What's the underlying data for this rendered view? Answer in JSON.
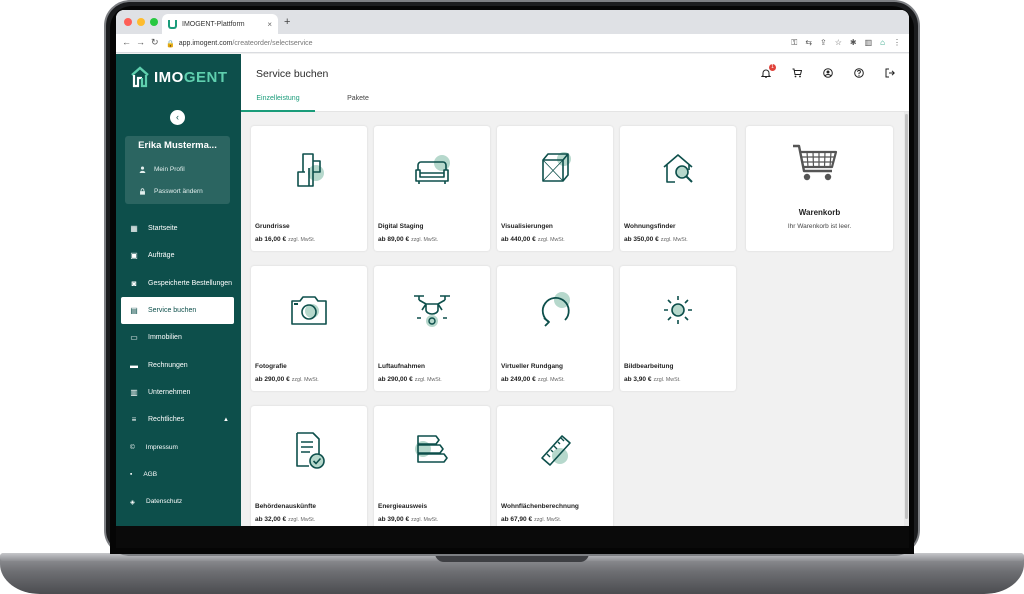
{
  "browser": {
    "tab_title": "IMOGENT-Plattform",
    "tab_close": "×",
    "new_tab": "+",
    "url_host": "app.imogent.com",
    "url_path": "/createorder/selectservice"
  },
  "brand": {
    "logo_im": "IMO",
    "logo_gent": "GENT",
    "primary_color": "#0d4f4b",
    "accent_color": "#1a9c7a"
  },
  "sidebar": {
    "profile_name": "Erika Musterma...",
    "profile_links": [
      {
        "label": "Mein Profil",
        "icon": "person-icon"
      },
      {
        "label": "Passwort ändern",
        "icon": "lock-icon"
      }
    ],
    "items": [
      {
        "label": "Startseite",
        "icon": "dashboard-icon"
      },
      {
        "label": "Aufträge",
        "icon": "briefcase-icon"
      },
      {
        "label": "Gespeicherte Bestellungen",
        "icon": "save-icon"
      },
      {
        "label": "Service buchen",
        "icon": "document-add-icon",
        "active": true
      },
      {
        "label": "Immobilien",
        "icon": "storefront-icon"
      },
      {
        "label": "Rechnungen",
        "icon": "credit-card-icon"
      },
      {
        "label": "Unternehmen",
        "icon": "building-icon"
      },
      {
        "label": "Rechtliches",
        "icon": "list-icon",
        "expanded": true
      }
    ],
    "legal_items": [
      {
        "label": "Impressum",
        "icon": "info-icon"
      },
      {
        "label": "AGB",
        "icon": "doc-icon"
      },
      {
        "label": "Datenschutz",
        "icon": "shield-icon"
      }
    ]
  },
  "header": {
    "title": "Service buchen",
    "tabs": [
      "Einzelleistung",
      "Pakete"
    ],
    "notification_count": "1"
  },
  "services": [
    {
      "title": "Grundrisse",
      "price": "ab 16,00 €",
      "vat": "zzgl. MwSt.",
      "icon": "floorplan-icon"
    },
    {
      "title": "Digital Staging",
      "price": "ab 89,00 €",
      "vat": "zzgl. MwSt.",
      "icon": "sofa-icon"
    },
    {
      "title": "Visualisierungen",
      "price": "ab 440,00 €",
      "vat": "zzgl. MwSt.",
      "icon": "cube-icon"
    },
    {
      "title": "Wohnungsfinder",
      "price": "ab 350,00 €",
      "vat": "zzgl. MwSt.",
      "icon": "house-search-icon"
    },
    {
      "title": "Fotografie",
      "price": "ab 290,00 €",
      "vat": "zzgl. MwSt.",
      "icon": "camera-icon"
    },
    {
      "title": "Luftaufnahmen",
      "price": "ab 290,00 €",
      "vat": "zzgl. MwSt.",
      "icon": "drone-icon"
    },
    {
      "title": "Virtueller Rundgang",
      "price": "ab 249,00 €",
      "vat": "zzgl. MwSt.",
      "icon": "rotate-icon"
    },
    {
      "title": "Bildbearbeitung",
      "price": "ab 3,90 €",
      "vat": "zzgl. MwSt.",
      "icon": "sun-icon"
    },
    {
      "title": "Behördenauskünfte",
      "price": "ab 32,00 €",
      "vat": "zzgl. MwSt.",
      "icon": "document-check-icon"
    },
    {
      "title": "Energieausweis",
      "price": "ab 39,00 €",
      "vat": "zzgl. MwSt.",
      "icon": "energy-bars-icon"
    },
    {
      "title": "Wohnflächenberechnung",
      "price": "ab 67,90 €",
      "vat": "zzgl. MwSt.",
      "icon": "ruler-icon"
    }
  ],
  "cart": {
    "title": "Warenkorb",
    "empty_text": "Ihr Warenkorb ist leer."
  }
}
